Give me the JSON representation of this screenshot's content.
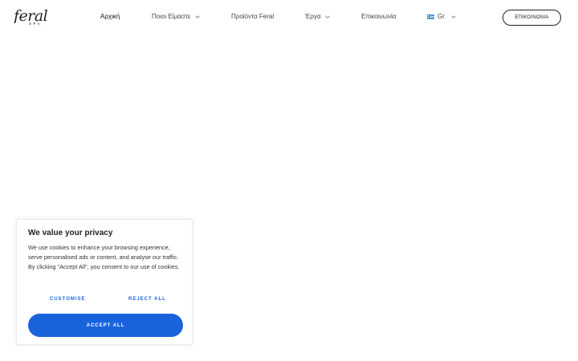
{
  "brand": {
    "logo_text": "feral",
    "logo_sub": "SPA"
  },
  "nav": {
    "items": [
      {
        "label": "Αρχική",
        "active": true,
        "dropdown": false
      },
      {
        "label": "Ποιοι Είμαστε",
        "active": false,
        "dropdown": true
      },
      {
        "label": "Προϊόντα Feral",
        "active": false,
        "dropdown": false
      },
      {
        "label": "Έργα",
        "active": false,
        "dropdown": true
      },
      {
        "label": "Επικοινωνία",
        "active": false,
        "dropdown": false
      }
    ],
    "language": {
      "label": "Gr",
      "flag_icon": "greek-flag-icon"
    },
    "contact_button": "ΕΠΙΚΟΙΝΩΝΙΑ"
  },
  "cookie_banner": {
    "title": "We value your privacy",
    "text": "We use cookies to enhance your browsing experience, serve personalised ads or content, and analyse our traffic. By clicking \"Accept All\", you consent to our use of cookies.",
    "customise_label": "CUSTOMISE",
    "reject_label": "REJECT ALL",
    "accept_label": "ACCEPT ALL",
    "accent_color": "#1863dc"
  }
}
